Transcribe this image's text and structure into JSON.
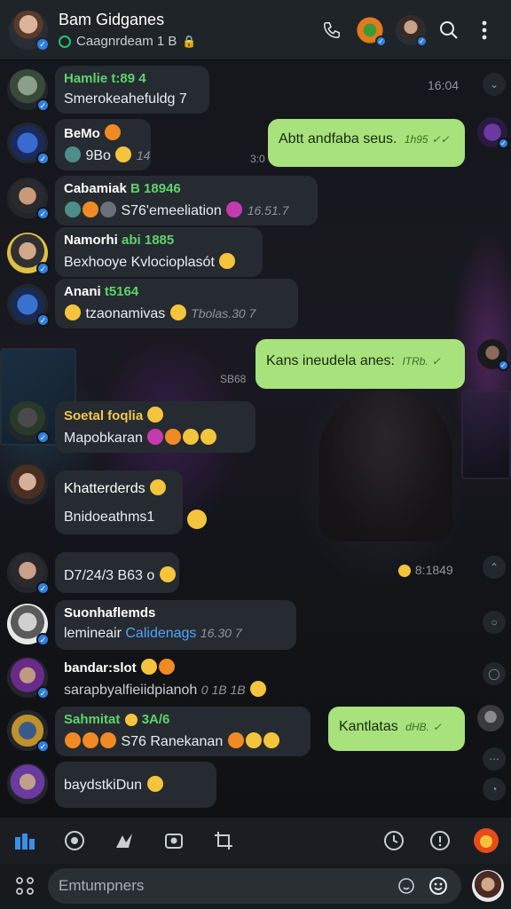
{
  "header": {
    "title": "Bam Gidganes",
    "subtitle": "Caagnrdeam 1 B",
    "icons": [
      "back-avatar",
      "call-icon",
      "avatar",
      "avatar",
      "search-icon",
      "more-icon"
    ]
  },
  "messages": [
    {
      "side": "in",
      "name": "Hamlie t:89 4",
      "name_color": "green",
      "text": "Smerokeahefuldg 7",
      "time": "16:04"
    },
    {
      "side": "in",
      "name": "BeMo",
      "text": "9Bo",
      "meta": "14",
      "time": ""
    },
    {
      "side": "out",
      "text": "Abtt andfaba seus.",
      "meta": "1h95",
      "time": "3:0"
    },
    {
      "side": "in",
      "name": "Cabamiak",
      "name_tag": "B 18946",
      "text": "S76'emeeliation",
      "meta": "16.51.7",
      "time": ""
    },
    {
      "side": "in",
      "name": "Namorhi",
      "name_tag": "abi 1885",
      "text": "Bexhooye Kvlocioplasót",
      "time": ""
    },
    {
      "side": "in",
      "name": "Anani",
      "name_tag": "t5164",
      "text": "tzaonamivas",
      "meta": "Tbolas.30 7",
      "time": ""
    },
    {
      "side": "out",
      "text": "Kans ineudela anes:",
      "meta": "ITRb.",
      "time": "SB68"
    },
    {
      "side": "in",
      "name": "Soetal foqlia",
      "name_color": "gold",
      "text": "Mapobkaran",
      "time": ""
    },
    {
      "side": "in",
      "name": "Khatterderds",
      "text": "Bnidoeathms1",
      "time": ""
    },
    {
      "side": "in",
      "name": "",
      "text": "D7/24/3 B63 o",
      "time": "8:1849"
    },
    {
      "side": "in",
      "name": "Suonhaflemds",
      "text": "lemineair",
      "link": "Calidenags",
      "meta": "16.30 7",
      "time": ""
    },
    {
      "side": "in",
      "name": "bandar:slot",
      "text": "sarapbyalfieiidpianoh",
      "meta": "0 1B 1B",
      "time": ""
    },
    {
      "side": "in",
      "name": "Sahmitat",
      "name_color": "green",
      "name_tag": "3A/6",
      "text": "S76 Ranekanan",
      "time": ""
    },
    {
      "side": "out",
      "text": "Kantlatas",
      "meta": "dHB.",
      "time": ""
    },
    {
      "side": "in",
      "name": "baydstkiDun",
      "text": "",
      "time": ""
    }
  ],
  "toolbar": {
    "icons": [
      "home-icon",
      "whatsapp-icon",
      "bird-icon",
      "camera-icon",
      "crop-icon",
      "clock-icon",
      "info-icon",
      "fire-icon"
    ]
  },
  "composer": {
    "placeholder": "Emtumpners",
    "icons": [
      "grid-icon",
      "sticker-icon",
      "emoji-icon",
      "avatar"
    ]
  },
  "colors": {
    "header_bg": "#1f2428",
    "bubble_in": "#262b31",
    "bubble_out": "#a7e27d",
    "accent_green": "#5ed36a",
    "badge_blue": "#2f7fe0"
  }
}
